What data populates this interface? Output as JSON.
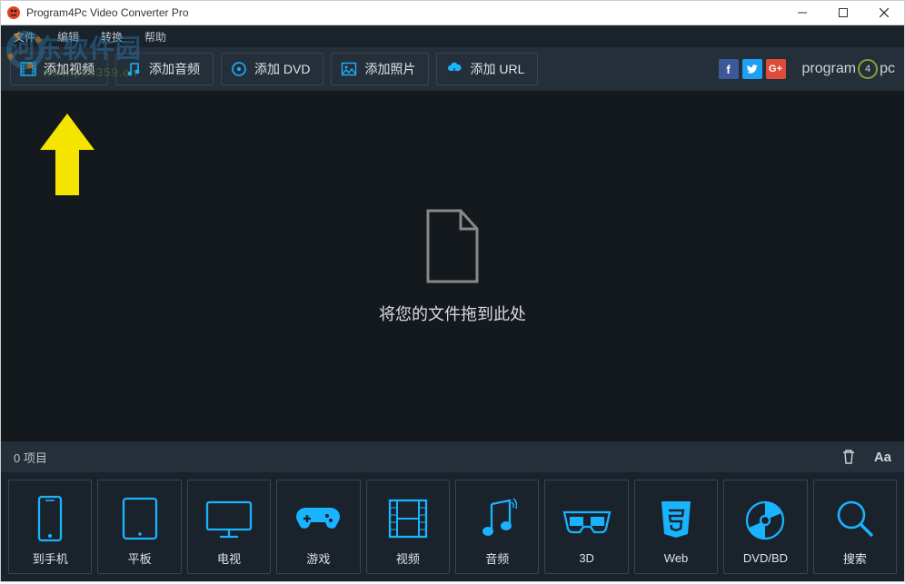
{
  "window": {
    "title": "Program4Pc Video Converter Pro"
  },
  "watermark": {
    "main": "河东软件园",
    "url": "www.pc0359.cn"
  },
  "menubar": {
    "items": [
      "文件",
      "编辑",
      "转换",
      "帮助"
    ]
  },
  "toolbar": {
    "buttons": {
      "add_video": "添加视频",
      "add_audio": "添加音频",
      "add_dvd": "添加 DVD",
      "add_photo": "添加照片",
      "add_url": "添加 URL"
    },
    "brand": {
      "pre": "program",
      "mid": "4",
      "post": "pc"
    }
  },
  "social": {
    "fb": "f",
    "tw": "t",
    "gp": "G+"
  },
  "dropzone": {
    "text": "将您的文件拖到此处"
  },
  "status": {
    "items_label": "0 项目",
    "delete_icon": "delete",
    "rename_icon": "Aa"
  },
  "categories": {
    "items": [
      {
        "key": "to_phone",
        "label": "到手机"
      },
      {
        "key": "tablet",
        "label": "平板"
      },
      {
        "key": "tv",
        "label": "电视"
      },
      {
        "key": "game",
        "label": "游戏"
      },
      {
        "key": "video",
        "label": "视频"
      },
      {
        "key": "audio",
        "label": "音频"
      },
      {
        "key": "3d",
        "label": "3D"
      },
      {
        "key": "web",
        "label": "Web"
      },
      {
        "key": "dvd_bd",
        "label": "DVD/BD"
      },
      {
        "key": "search",
        "label": "搜索"
      }
    ]
  },
  "colors": {
    "accent": "#18b4ff",
    "bg_dark": "#14191e",
    "bg_panel": "#252f3a",
    "bg_app": "#1a222b",
    "hint_arrow": "#f5e400"
  }
}
